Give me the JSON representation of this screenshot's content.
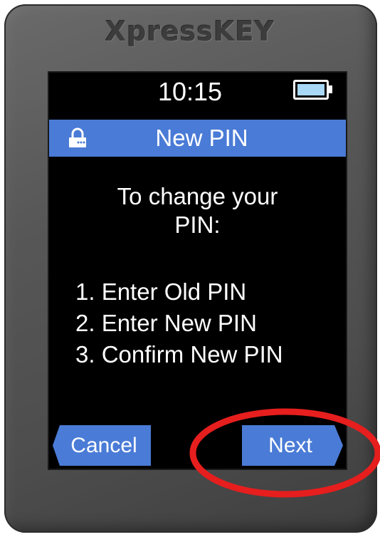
{
  "device": {
    "brand": "XpressKEY"
  },
  "status_bar": {
    "time": "10:15",
    "battery_icon": "battery-icon"
  },
  "title_bar": {
    "icon": "lock-icon",
    "title": "New PIN"
  },
  "content": {
    "intro_line1": "To change your",
    "intro_line2": "PIN:",
    "steps": [
      "1. Enter Old PIN",
      "2. Enter New PIN",
      "3. Confirm New PIN"
    ]
  },
  "buttons": {
    "cancel_label": "Cancel",
    "next_label": "Next"
  },
  "colors": {
    "accent": "#4a7bd6",
    "screen_bg": "#000000",
    "highlight": "#e61e1e",
    "battery_fill": "#a8d8f5"
  }
}
